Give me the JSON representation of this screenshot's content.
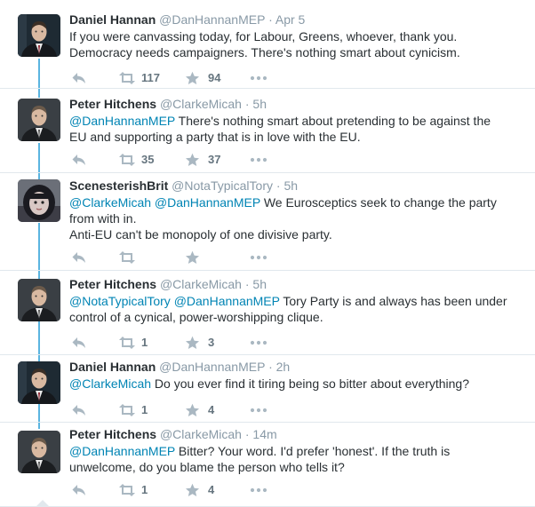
{
  "tweets": [
    {
      "name": "Daniel Hannan",
      "handle": "@DanHannanMEP",
      "sep": "·",
      "time": "Apr 5",
      "avatar": "suited-man-portrait",
      "lines": [
        [
          {
            "t": "If you were canvassing today, for Labour, Greens, whoever, thank you."
          }
        ],
        [
          {
            "t": "Democracy needs campaigners. There's nothing smart about cynicism."
          }
        ]
      ],
      "retweets": "117",
      "favorites": "94"
    },
    {
      "name": "Peter Hitchens",
      "handle": "@ClarkeMicah",
      "sep": "·",
      "time": "5h",
      "avatar": "man-in-dark-suit-portrait",
      "lines": [
        [
          {
            "t": "@DanHannanMEP",
            "m": true
          },
          {
            "t": " There's nothing smart about pretending to be against the"
          }
        ],
        [
          {
            "t": "EU and supporting a party that is in love with the EU."
          }
        ]
      ],
      "retweets": "35",
      "favorites": "37"
    },
    {
      "name": "ScenesterishBrit",
      "handle": "@NotaTypicalTory",
      "sep": "·",
      "time": "5h",
      "avatar": "woman-dark-hair-portrait",
      "lines": [
        [
          {
            "t": "@ClarkeMicah",
            "m": true
          },
          {
            "t": " "
          },
          {
            "t": "@DanHannanMEP",
            "m": true
          },
          {
            "t": " We Eurosceptics seek to change the party"
          }
        ],
        [
          {
            "t": "from with in."
          }
        ],
        [
          {
            "t": "Anti-EU can't be monopoly of one divisive party."
          }
        ]
      ],
      "retweets": "",
      "favorites": ""
    },
    {
      "name": "Peter Hitchens",
      "handle": "@ClarkeMicah",
      "sep": "·",
      "time": "5h",
      "avatar": "man-in-dark-suit-portrait",
      "lines": [
        [
          {
            "t": "@NotaTypicalTory",
            "m": true
          },
          {
            "t": " "
          },
          {
            "t": "@DanHannanMEP",
            "m": true
          },
          {
            "t": " Tory Party is and always has been under"
          }
        ],
        [
          {
            "t": "control of a cynical, power-worshipping clique."
          }
        ]
      ],
      "retweets": "1",
      "favorites": "3"
    },
    {
      "name": "Daniel Hannan",
      "handle": "@DanHannanMEP",
      "sep": "·",
      "time": "2h",
      "avatar": "suited-man-portrait",
      "lines": [
        [
          {
            "t": "@ClarkeMicah",
            "m": true
          },
          {
            "t": " Do you ever find it tiring being so bitter about everything?"
          }
        ]
      ],
      "retweets": "1",
      "favorites": "4"
    },
    {
      "name": "Peter Hitchens",
      "handle": "@ClarkeMicah",
      "sep": "·",
      "time": "14m",
      "avatar": "man-in-dark-suit-portrait",
      "lines": [
        [
          {
            "t": "@DanHannanMEP",
            "m": true
          },
          {
            "t": " Bitter? Your word. I'd prefer 'honest'. If the truth is"
          }
        ],
        [
          {
            "t": "unwelcome, do you blame the person who tells it?"
          }
        ]
      ],
      "retweets": "1",
      "favorites": "4"
    }
  ],
  "icons": {
    "reply": "reply-icon",
    "retweet": "retweet-icon",
    "favorite": "star-icon",
    "more": "more-icon"
  },
  "colors": {
    "mention": "#0084b4",
    "meta": "#8899a6",
    "connector": "#5bb5e0",
    "divider": "#e1e8ed"
  }
}
